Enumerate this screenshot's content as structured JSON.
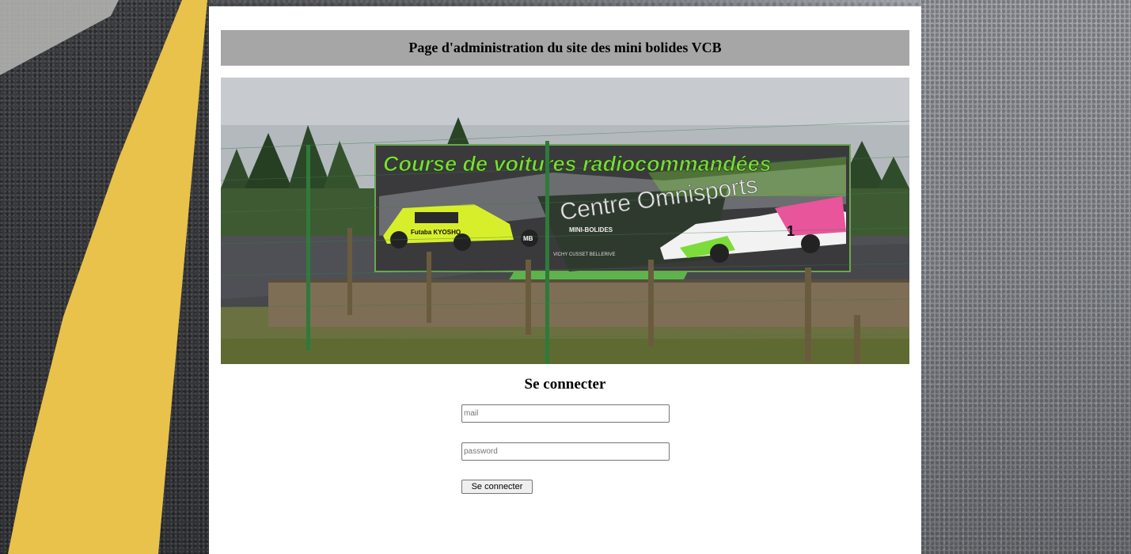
{
  "header": {
    "title": "Page d'administration du site des mini bolides VCB"
  },
  "banner": {
    "headline": "Course de voitures radiocommandées",
    "subheadline": "Centre Omnisports",
    "logo_text": "MINI-BOLIDES",
    "logo_badge": "MB",
    "logo_sub": "VICHY CUSSET BELLERIVE",
    "car_number": "1",
    "car_sponsor": "Futaba KYOSHO"
  },
  "login": {
    "title": "Se connecter",
    "mail_placeholder": "mail",
    "password_placeholder": "password",
    "submit_label": "Se connecter"
  },
  "colors": {
    "title_bar": "#a6a6a6",
    "banner_green": "#7ddb3a",
    "road_yellow": "#e8c24a"
  }
}
